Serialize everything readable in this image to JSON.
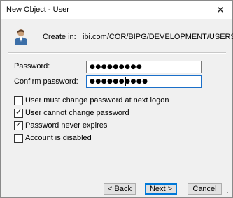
{
  "window": {
    "title": "New Object - User",
    "close_icon": "close-icon"
  },
  "header": {
    "icon": "user-avatar-icon",
    "create_in_label": "Create in:",
    "create_in_path": "ibi.com/COR/BIPG/DEVELOPMENT/USERS"
  },
  "password": {
    "label": "Password:",
    "value": "●●●●●●●●●"
  },
  "confirm_password": {
    "label": "Confirm password:",
    "value": "●●●●●●●●●●"
  },
  "options": [
    {
      "label": "User must change password at next logon",
      "checked": false
    },
    {
      "label": "User cannot change password",
      "checked": true
    },
    {
      "label": "Password never expires",
      "checked": true
    },
    {
      "label": "Account is disabled",
      "checked": false
    }
  ],
  "buttons": {
    "back": "< Back",
    "next": "Next >",
    "cancel": "Cancel"
  },
  "colors": {
    "accent": "#0078d7",
    "panel": "#f0f0f0"
  }
}
